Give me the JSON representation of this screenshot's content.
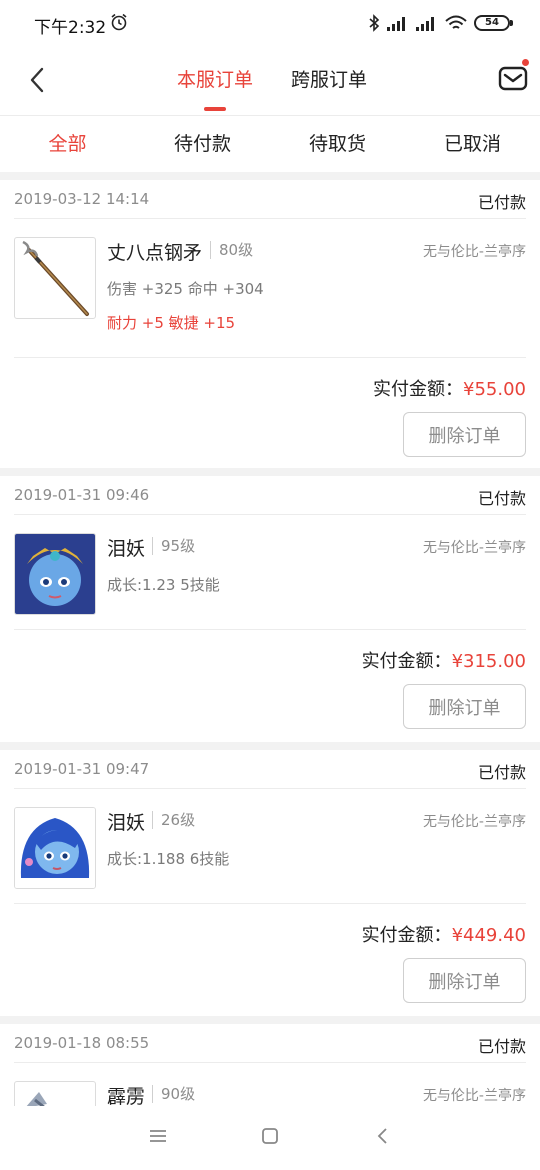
{
  "status_bar": {
    "time": "下午2:32",
    "battery": "54"
  },
  "header": {
    "tabs": [
      {
        "label": "本服订单",
        "active": true
      },
      {
        "label": "跨服订单",
        "active": false
      }
    ]
  },
  "filters": [
    {
      "label": "全部",
      "active": true
    },
    {
      "label": "待付款",
      "active": false
    },
    {
      "label": "待取货",
      "active": false
    },
    {
      "label": "已取消",
      "active": false
    }
  ],
  "colors": {
    "accent": "#e8433a",
    "muted": "#8c8c8c",
    "divider": "#f2f2f2"
  },
  "orders": [
    {
      "date": "2019-03-12 14:14",
      "status": "已付款",
      "name": "丈八点钢矛",
      "level": "80级",
      "server": "无与伦比-兰亭序",
      "attr1": "伤害 +325 命中 +304",
      "attr2": "耐力 +5 敏捷 +15",
      "pay_label": "实付金额：",
      "amount": "¥55.00",
      "delete_label": "删除订单",
      "thumb_icon": "spear-icon"
    },
    {
      "date": "2019-01-31 09:46",
      "status": "已付款",
      "name": "泪妖",
      "level": "95级",
      "server": "无与伦比-兰亭序",
      "attr1": "成长:1.23 5技能",
      "pay_label": "实付金额：",
      "amount": "¥315.00",
      "delete_label": "删除订单",
      "thumb_icon": "pet-portrait-icon"
    },
    {
      "date": "2019-01-31 09:47",
      "status": "已付款",
      "name": "泪妖",
      "level": "26级",
      "server": "无与伦比-兰亭序",
      "attr1": "成长:1.188 6技能",
      "pay_label": "实付金额：",
      "amount": "¥449.40",
      "delete_label": "删除订单",
      "thumb_icon": "pet-portrait-icon"
    },
    {
      "date": "2019-01-18 08:55",
      "status": "已付款",
      "name": "霹雳",
      "level": "90级",
      "server": "无与伦比-兰亭序",
      "thumb_icon": "weapon-icon"
    }
  ]
}
